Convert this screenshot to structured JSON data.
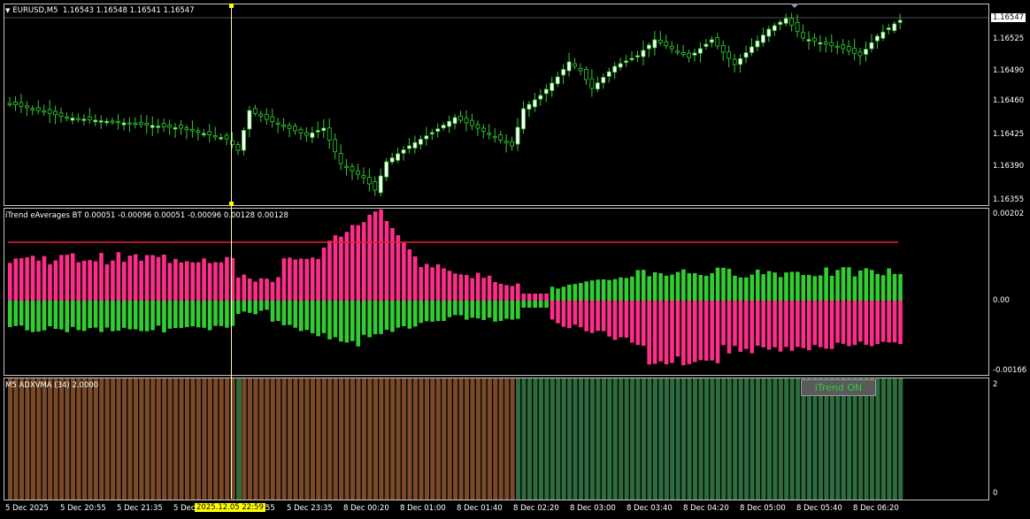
{
  "symbol_header": {
    "symbol": "EURUSD,M5",
    "ohlc": "1.16543 1.16548 1.16541 1.16547"
  },
  "price_scale": [
    "1.16547",
    "1.16525",
    "1.16490",
    "1.16460",
    "1.16425",
    "1.16390",
    "1.16355"
  ],
  "current_price": "1.16547",
  "indicator1": {
    "label": "iTrend eAverages BT 0.00051 -0.00096 0.00051 -0.00096 0.00128 0.00128",
    "scale": [
      "0.00202",
      "0.00",
      "-0.00166"
    ]
  },
  "indicator2": {
    "label": "M5 ADXVMA (34) 2.0000",
    "scale": [
      "2",
      "0"
    ]
  },
  "button": {
    "label": "iTrend ON"
  },
  "time_axis": [
    "5 Dec 2025",
    "5 Dec 20:55",
    "5 Dec 21:35",
    "5 Dec",
    "55",
    "5 Dec 23:35",
    "8 Dec 00:20",
    "8 Dec 01:00",
    "8 Dec 01:40",
    "8 Dec 02:20",
    "8 Dec 03:00",
    "8 Dec 03:40",
    "8 Dec 04:20",
    "8 Dec 05:00",
    "8 Dec 05:40",
    "8 Dec 06:20"
  ],
  "crosshair_time": "2025.12.05 22:59",
  "colors": {
    "bull": "#32cd32",
    "bear": "#ff2d8a",
    "brown": "#7a4a28",
    "green_bar": "#2e6b3e",
    "signal_line": "#e8203c",
    "crosshair": "#ffff00"
  }
}
